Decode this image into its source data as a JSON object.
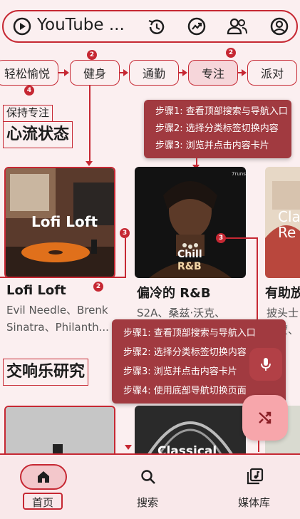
{
  "header": {
    "title": "YouTube ...",
    "icons": [
      "play-circle-icon",
      "history-icon",
      "trending-icon",
      "people-icon",
      "account-icon"
    ]
  },
  "chips": [
    {
      "label": "轻松愉悦",
      "selected": false,
      "badge": "4"
    },
    {
      "label": "健身",
      "selected": false,
      "badge": "2"
    },
    {
      "label": "通勤",
      "selected": false,
      "badge": ""
    },
    {
      "label": "专注",
      "selected": true,
      "badge": "2"
    },
    {
      "label": "派对",
      "selected": false,
      "badge": ""
    }
  ],
  "section1": {
    "subtitle": "保持专注",
    "title": "心流状态"
  },
  "tooltip_top": {
    "steps": [
      "步骤1: 查看顶部搜索与导航入口",
      "步骤2: 选择分类标签切换内容",
      "步骤3: 浏览并点击内容卡片"
    ]
  },
  "tooltip_mid": {
    "steps": [
      "步骤1: 查看顶部搜索与导航入口",
      "步骤2: 选择分类标签切换内容",
      "步骤3: 浏览并点击内容卡片",
      "步骤4: 使用底部导航切换页面"
    ]
  },
  "cards": [
    {
      "art_text": "Lofi Loft",
      "title": "Lofi Loft",
      "subtitle_line1": "Evil Needle、Brenk",
      "subtitle_line2": "Sinatra、Philanth...",
      "badge": "2"
    },
    {
      "art_text_1": "Chill",
      "art_text_2": "R&B",
      "corner": "7runs",
      "title": "偏冷的 R&B",
      "subtitle_line1": "S2A、桑兹·沃克、",
      "subtitle_line2": ""
    },
    {
      "art_text_1": "Cla",
      "art_text_2": "Re",
      "title": "有助放",
      "subtitle_line1": "披头士",
      "subtitle_line2": "西蒙、"
    }
  ],
  "card_badge_mid": "3",
  "card_badge_left": "3",
  "section2": {
    "title": "交响乐研究"
  },
  "row2": [
    {
      "art_text": ""
    },
    {
      "art_text": "Classical"
    },
    {
      "art_text": ""
    }
  ],
  "bottom_nav": [
    {
      "label": "首页",
      "icon": "home-icon",
      "active": true
    },
    {
      "label": "搜索",
      "icon": "search-icon",
      "active": false
    },
    {
      "label": "媒体库",
      "icon": "library-icon",
      "active": false
    }
  ],
  "colors": {
    "accent": "#c62833",
    "tooltip": "#a13a40",
    "background": "#fbeff0",
    "fab": "#f7a6ab"
  }
}
